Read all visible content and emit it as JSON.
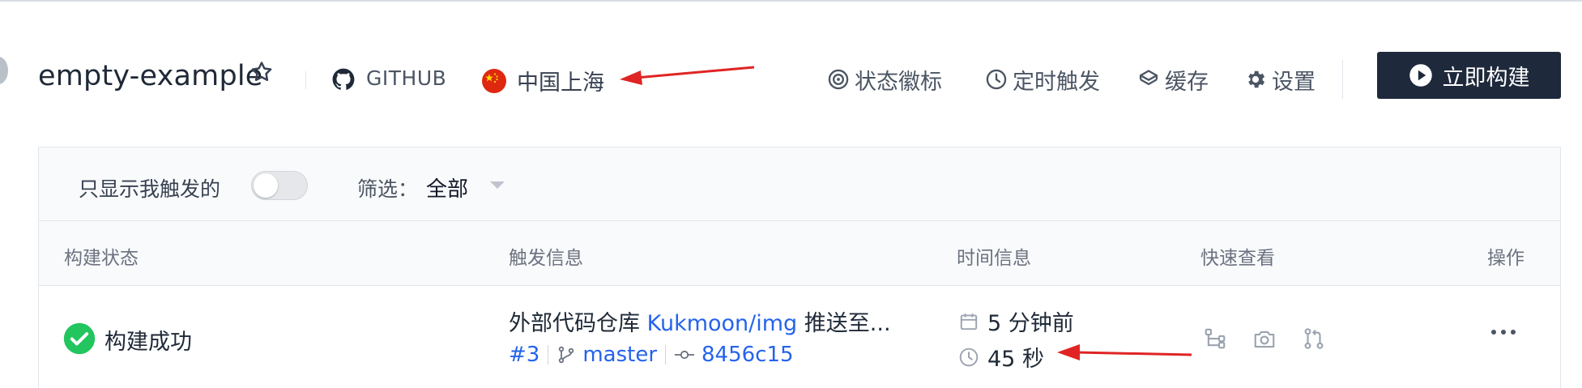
{
  "header": {
    "project_name": "empty-example",
    "source_label": "GITHUB",
    "region": "中国上海",
    "actions": {
      "badge": "状态徽标",
      "schedule": "定时触发",
      "cache": "缓存",
      "settings": "设置"
    },
    "build_button": "立即构建"
  },
  "filters": {
    "only_mine_label": "只显示我触发的",
    "only_mine_enabled": false,
    "filter_key": "筛选：",
    "filter_value": "全部"
  },
  "table": {
    "columns": [
      "构建状态",
      "触发信息",
      "时间信息",
      "快速查看",
      "操作"
    ],
    "rows": [
      {
        "status": "构建成功",
        "trigger_prefix": "外部代码仓库",
        "trigger_repo": "Kukmoon/img",
        "trigger_suffix": "推送至...",
        "build_number": "#3",
        "branch": "master",
        "commit": "8456c15",
        "time_ago": "5 分钟前",
        "duration": "45 秒"
      }
    ]
  },
  "colors": {
    "primary_button": "#1e293b",
    "link": "#2563eb",
    "success": "#22c55e",
    "annotation_arrow": "#e02424"
  },
  "icons": {
    "star": "star-icon",
    "github": "github-icon",
    "flag": "china-flag-icon",
    "badge": "badge-icon",
    "schedule": "clock-icon",
    "cache": "layers-icon",
    "settings": "gear-icon",
    "play": "play-icon",
    "success": "check-circle-icon",
    "branch": "branch-icon",
    "commit": "commit-icon",
    "calendar": "calendar-icon",
    "duration": "clock-icon",
    "pipeline": "pipeline-icon",
    "snapshot": "camera-icon",
    "pull_request": "pull-request-icon",
    "more": "more-icon"
  }
}
